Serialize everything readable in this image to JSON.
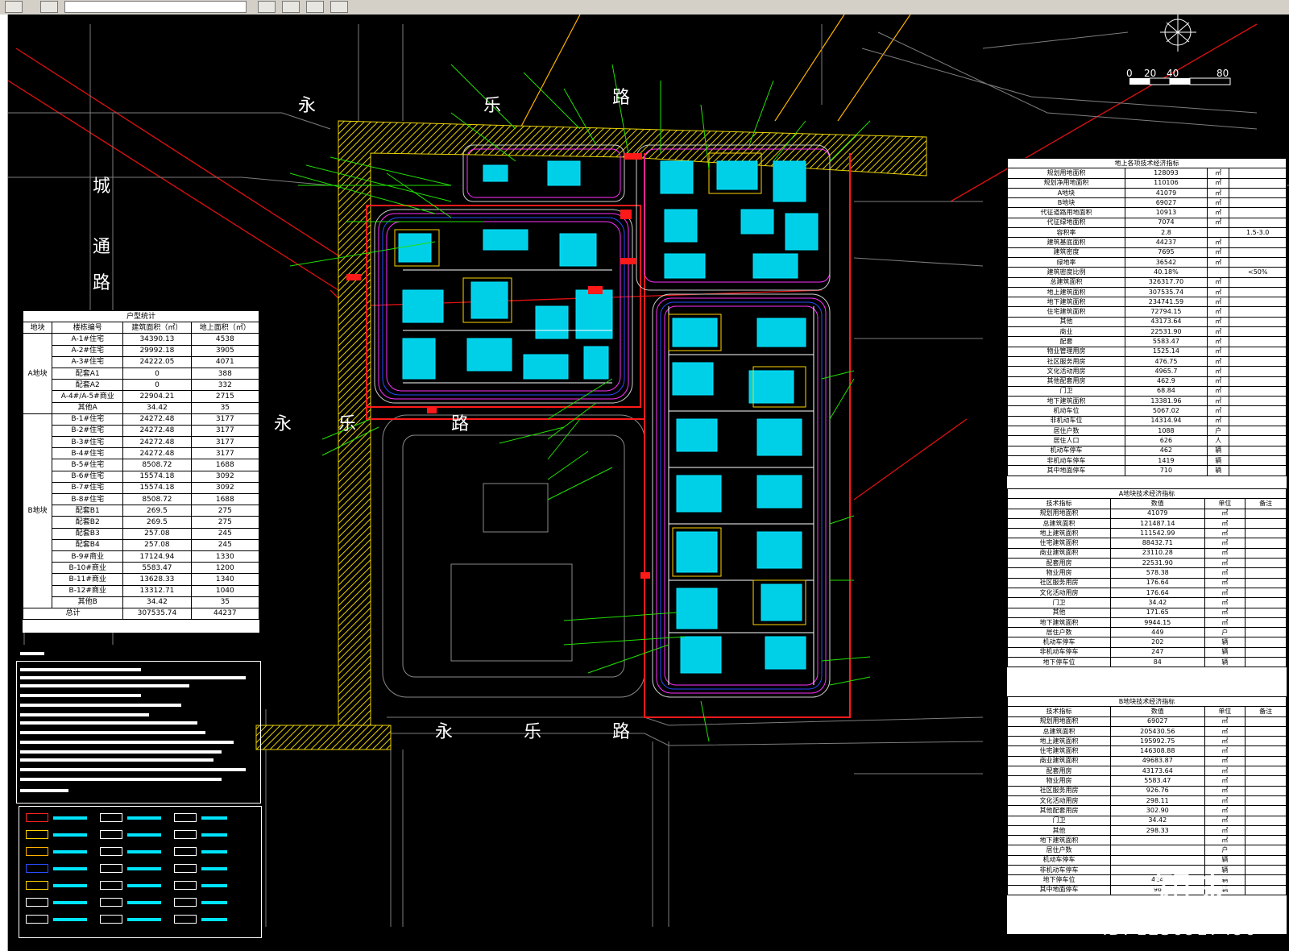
{
  "watermark": {
    "logo": "知末",
    "id": "ID: 1230917490"
  },
  "scale": {
    "ticks": [
      "0",
      "20",
      "40",
      "80"
    ]
  },
  "roads": [
    "永",
    "乐",
    "路",
    "永",
    "乐",
    "路",
    "城",
    "通",
    "路",
    "永",
    "乐",
    "路"
  ],
  "left_table": {
    "title": "户型统计",
    "headers": [
      "地块",
      "楼栋编号",
      "建筑面积（㎡）",
      "地上面积（㎡）"
    ],
    "a_label": "A地块",
    "b_label": "B地块",
    "rows_a": [
      [
        "A-1#住宅",
        "34390.13",
        "4538"
      ],
      [
        "A-2#住宅",
        "29992.18",
        "3905"
      ],
      [
        "A-3#住宅",
        "24222.05",
        "4071"
      ],
      [
        "配套A1",
        "0",
        "388"
      ],
      [
        "配套A2",
        "0",
        "332"
      ],
      [
        "A-4#/A-5#商业",
        "22904.21",
        "2715"
      ],
      [
        "其他A",
        "34.42",
        "35"
      ]
    ],
    "rows_b": [
      [
        "B-1#住宅",
        "24272.48",
        "3177"
      ],
      [
        "B-2#住宅",
        "24272.48",
        "3177"
      ],
      [
        "B-3#住宅",
        "24272.48",
        "3177"
      ],
      [
        "B-4#住宅",
        "24272.48",
        "3177"
      ],
      [
        "B-5#住宅",
        "8508.72",
        "1688"
      ],
      [
        "B-6#住宅",
        "15574.18",
        "3092"
      ],
      [
        "B-7#住宅",
        "15574.18",
        "3092"
      ],
      [
        "B-8#住宅",
        "8508.72",
        "1688"
      ],
      [
        "配套B1",
        "269.5",
        "275"
      ],
      [
        "配套B2",
        "269.5",
        "275"
      ],
      [
        "配套B3",
        "257.08",
        "245"
      ],
      [
        "配套B4",
        "257.08",
        "245"
      ],
      [
        "B-9#商业",
        "17124.94",
        "1330"
      ],
      [
        "B-10#商业",
        "5583.47",
        "1200"
      ],
      [
        "B-11#商业",
        "13628.33",
        "1340"
      ],
      [
        "B-12#商业",
        "13312.71",
        "1040"
      ],
      [
        "其他B",
        "34.42",
        "35"
      ]
    ],
    "total": [
      "总计",
      "307535.74",
      "44237"
    ]
  },
  "right_table_1": {
    "title": "地上各项技术经济指标",
    "rows": [
      [
        "规划用地面积",
        "128093",
        "㎡",
        ""
      ],
      [
        "规划净用地面积",
        "110106",
        "㎡",
        ""
      ],
      [
        "A地块",
        "41079",
        "㎡",
        ""
      ],
      [
        "B地块",
        "69027",
        "㎡",
        ""
      ],
      [
        "代征道路用地面积",
        "10913",
        "㎡",
        ""
      ],
      [
        "代征绿地面积",
        "7074",
        "㎡",
        ""
      ],
      [
        "容积率",
        "2.8",
        "",
        "1.5-3.0"
      ],
      [
        "建筑基底面积",
        "44237",
        "㎡",
        ""
      ],
      [
        "建筑密度",
        "7695",
        "㎡",
        ""
      ],
      [
        "绿地率",
        "36542",
        "㎡",
        ""
      ],
      [
        "建筑密度比例",
        "40.18%",
        "",
        "<50%"
      ],
      [
        "总建筑面积",
        "326317.70",
        "㎡",
        ""
      ],
      [
        "地上建筑面积",
        "307535.74",
        "㎡",
        ""
      ],
      [
        "地下建筑面积",
        "234741.59",
        "㎡",
        ""
      ],
      [
        "住宅建筑面积",
        "72794.15",
        "㎡",
        ""
      ],
      [
        "其他",
        "43173.64",
        "㎡",
        ""
      ],
      [
        "商业",
        "22531.90",
        "㎡",
        ""
      ],
      [
        "配套",
        "5583.47",
        "㎡",
        ""
      ],
      [
        "物业管理用房",
        "1525.14",
        "㎡",
        ""
      ],
      [
        "社区服务用房",
        "476.75",
        "㎡",
        ""
      ],
      [
        "文化活动用房",
        "4965.7",
        "㎡",
        ""
      ],
      [
        "其他配套用房",
        "462.9",
        "㎡",
        ""
      ],
      [
        "门卫",
        "68.84",
        "㎡",
        ""
      ],
      [
        "地下建筑面积",
        "13381.96",
        "㎡",
        ""
      ],
      [
        "机动车位",
        "5067.02",
        "㎡",
        ""
      ],
      [
        "非机动车位",
        "14314.94",
        "㎡",
        ""
      ],
      [
        "居住户数",
        "1088",
        "户",
        ""
      ],
      [
        "居住人口",
        "626",
        "人",
        ""
      ],
      [
        "机动车停车",
        "462",
        "辆",
        ""
      ],
      [
        "非机动车停车",
        "1419",
        "辆",
        ""
      ],
      [
        "其中地面停车",
        "710",
        "辆",
        ""
      ]
    ]
  },
  "right_table_2": {
    "title": "A地块技术经济指标",
    "header": [
      "技术指标",
      "数值",
      "单位",
      "备注"
    ],
    "rows": [
      [
        "规划用地面积",
        "41079",
        "㎡",
        ""
      ],
      [
        "总建筑面积",
        "121487.14",
        "㎡",
        ""
      ],
      [
        "地上建筑面积",
        "111542.99",
        "㎡",
        ""
      ],
      [
        "住宅建筑面积",
        "88432.71",
        "㎡",
        ""
      ],
      [
        "商业建筑面积",
        "23110.28",
        "㎡",
        ""
      ],
      [
        "配套用房",
        "22531.90",
        "㎡",
        ""
      ],
      [
        "物业用房",
        "578.38",
        "㎡",
        ""
      ],
      [
        "社区服务用房",
        "176.64",
        "㎡",
        ""
      ],
      [
        "文化活动用房",
        "176.64",
        "㎡",
        ""
      ],
      [
        "门卫",
        "34.42",
        "㎡",
        ""
      ],
      [
        "其他",
        "171.65",
        "㎡",
        ""
      ],
      [
        "地下建筑面积",
        "9944.15",
        "㎡",
        ""
      ],
      [
        "居住户数",
        "449",
        "户",
        ""
      ],
      [
        "机动车停车",
        "202",
        "辆",
        ""
      ],
      [
        "非机动车停车",
        "247",
        "辆",
        ""
      ],
      [
        "地下停车位",
        "84",
        "辆",
        ""
      ]
    ]
  },
  "right_table_3": {
    "title": "B地块技术经济指标",
    "header": [
      "技术指标",
      "数值",
      "单位",
      "备注"
    ],
    "rows": [
      [
        "规划用地面积",
        "69027",
        "㎡",
        ""
      ],
      [
        "总建筑面积",
        "205430.56",
        "㎡",
        ""
      ],
      [
        "地上建筑面积",
        "195992.75",
        "㎡",
        ""
      ],
      [
        "住宅建筑面积",
        "146308.88",
        "㎡",
        ""
      ],
      [
        "商业建筑面积",
        "49683.87",
        "㎡",
        ""
      ],
      [
        "配套用房",
        "43173.64",
        "㎡",
        ""
      ],
      [
        "物业用房",
        "5583.47",
        "㎡",
        ""
      ],
      [
        "社区服务用房",
        "926.76",
        "㎡",
        ""
      ],
      [
        "文化活动用房",
        "298.11",
        "㎡",
        ""
      ],
      [
        "其他配套用房",
        "302.90",
        "㎡",
        ""
      ],
      [
        "门卫",
        "34.42",
        "㎡",
        ""
      ],
      [
        "其他",
        "298.33",
        "㎡",
        ""
      ],
      [
        "地下建筑面积",
        "",
        "㎡",
        ""
      ],
      [
        "居住户数",
        "",
        "户",
        ""
      ],
      [
        "机动车停车",
        "",
        "辆",
        ""
      ],
      [
        "非机动车停车",
        "",
        "辆",
        ""
      ],
      [
        "地下停车位",
        "424",
        "辆",
        ""
      ],
      [
        "其中地面停车",
        "96",
        "辆",
        ""
      ]
    ]
  },
  "colors": {
    "road_fill": "#e8d100",
    "red": "#ff1a1a",
    "green": "#22e000",
    "cyan": "#00e5ff",
    "magenta": "#ff30ff",
    "yellow": "#ffd400",
    "blue": "#2a4dff"
  }
}
